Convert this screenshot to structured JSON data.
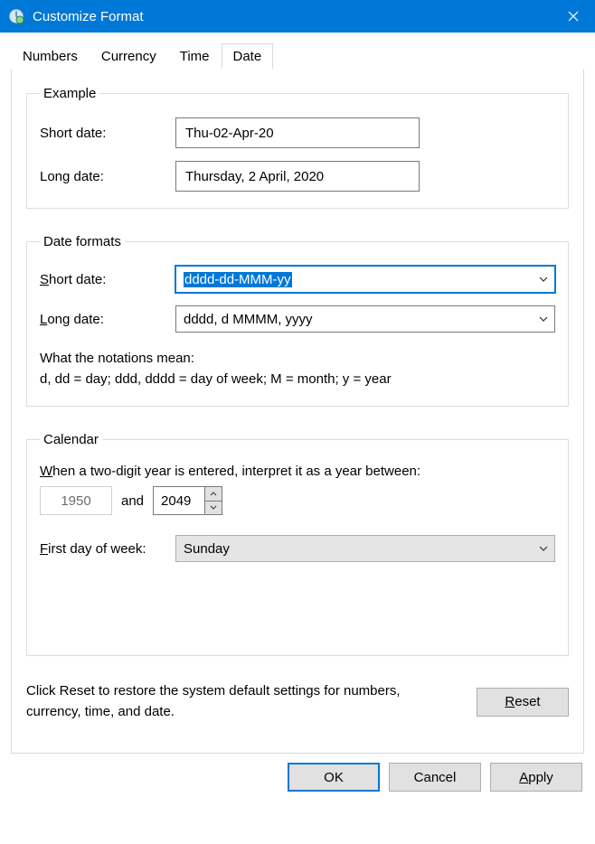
{
  "window": {
    "title": "Customize Format"
  },
  "tabs": {
    "numbers": "Numbers",
    "currency": "Currency",
    "time": "Time",
    "date": "Date"
  },
  "example": {
    "legend": "Example",
    "short_label": "Short date:",
    "short_value": "Thu-02-Apr-20",
    "long_label": "Long date:",
    "long_value": "Thursday, 2 April, 2020"
  },
  "formats": {
    "legend": "Date formats",
    "short_label_pre": "S",
    "short_label_post": "hort date:",
    "short_value": "dddd-dd-MMM-yy",
    "long_label_pre": "L",
    "long_label_post": "ong date:",
    "long_value": "dddd, d MMMM, yyyy",
    "notation_heading": "What the notations mean:",
    "notation_body": "d, dd = day;  ddd, dddd = day of week;  M = month;  y = year"
  },
  "calendar": {
    "legend": "Calendar",
    "sentence_pre": "W",
    "sentence_post": "hen a two-digit year is entered, interpret it as a year between:",
    "year_from": "1950",
    "and": "and",
    "year_to": "2049",
    "first_day_pre": "F",
    "first_day_post": "irst day of week:",
    "first_day_value": "Sunday"
  },
  "reset": {
    "text": "Click Reset to restore the system default settings for numbers, currency, time, and date.",
    "button_pre": "R",
    "button_post": "eset"
  },
  "actions": {
    "ok": "OK",
    "cancel": "Cancel",
    "apply_pre": "A",
    "apply_post": "pply"
  }
}
